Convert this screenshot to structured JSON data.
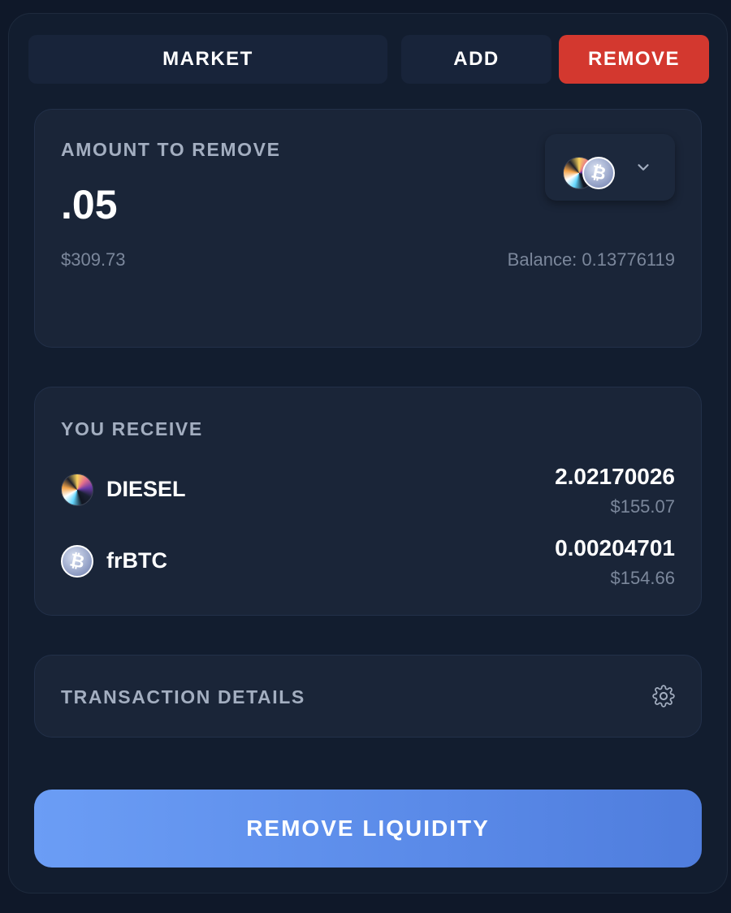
{
  "tabs": {
    "market": "MARKET",
    "add": "ADD",
    "remove": "REMOVE"
  },
  "amount_card": {
    "label": "AMOUNT TO REMOVE",
    "amount": ".05",
    "usd_value": "$309.73",
    "balance": "Balance: 0.13776119",
    "token_pair_icons": [
      "diesel-coin-icon",
      "btc-coin-icon"
    ]
  },
  "receive_card": {
    "label": "YOU RECEIVE",
    "tokens": [
      {
        "symbol": "DIESEL",
        "amount": "2.02170026",
        "usd": "$155.07",
        "icon": "diesel-coin-icon"
      },
      {
        "symbol": "frBTC",
        "amount": "0.00204701",
        "usd": "$154.66",
        "icon": "btc-coin-icon"
      }
    ]
  },
  "details": {
    "label": "TRANSACTION DETAILS",
    "icon": "gear-icon"
  },
  "submit": {
    "label": "REMOVE LIQUIDITY"
  },
  "colors": {
    "page_bg": "#0f1829",
    "panel_bg": "#121d2f",
    "card_bg": "#1a2538",
    "remove_red": "#d3382f",
    "cta_blue": "#5a8ae8",
    "muted_text": "#7b879b",
    "label_text": "#a3aec0"
  }
}
